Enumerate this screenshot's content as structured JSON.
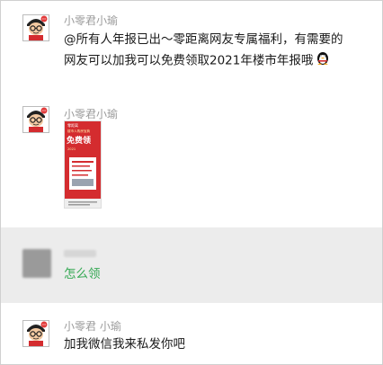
{
  "messages": [
    {
      "name": "小零君小瑜",
      "lines": [
        "@所有人年报已出～零距离网友专属福利，有需要的",
        "网友可以加我可以免费领取2021年楼市年报哦"
      ],
      "emoji": "penguin-icon"
    },
    {
      "name": "小零君小瑜",
      "image": {
        "header": "零距离",
        "subtitle": "楼市人购房宝典",
        "headline": "免费领",
        "year": "2021"
      }
    },
    {
      "text": "怎么领"
    },
    {
      "name": "小零君 小瑜",
      "text": "加我微信我来私发你吧"
    }
  ],
  "colors": {
    "name": "#9b9b9b",
    "text": "#1a1a1a",
    "highlight_text": "#34a853",
    "selected_bg": "#ececec",
    "poster_red": "#d42c2f"
  }
}
